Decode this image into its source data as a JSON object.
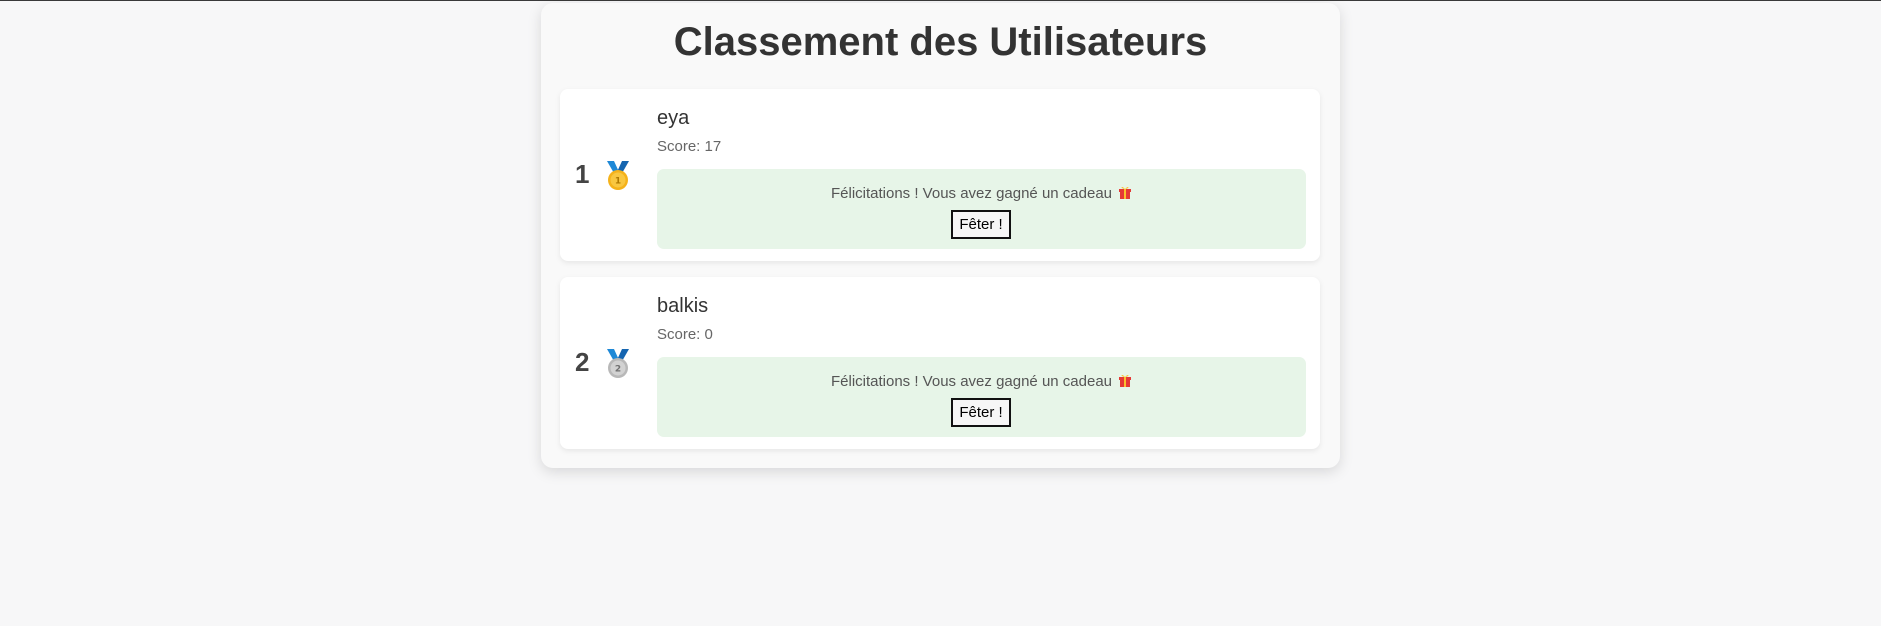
{
  "page": {
    "title": "Classement des Utilisateurs"
  },
  "users": [
    {
      "rank": "1",
      "medal_icon": "gold-medal-icon",
      "medal_number": "1",
      "name": "eya",
      "score_text": "Score: 17",
      "gift_message": "Félicitations ! Vous avez gagné un cadeau",
      "gift_icon": "gift-icon",
      "button_label": "Fêter !"
    },
    {
      "rank": "2",
      "medal_icon": "silver-medal-icon",
      "medal_number": "2",
      "name": "balkis",
      "score_text": "Score: 0",
      "gift_message": "Félicitations ! Vous avez gagné un cadeau",
      "gift_icon": "gift-icon",
      "button_label": "Fêter !"
    }
  ],
  "colors": {
    "background": "#f7f7f8",
    "panel": "#f9f9f9",
    "card": "#ffffff",
    "gift_box": "#e7f5e8",
    "gold": "#f5b21a",
    "silver": "#b8b8b8",
    "ribbon": "#1e88d6"
  }
}
